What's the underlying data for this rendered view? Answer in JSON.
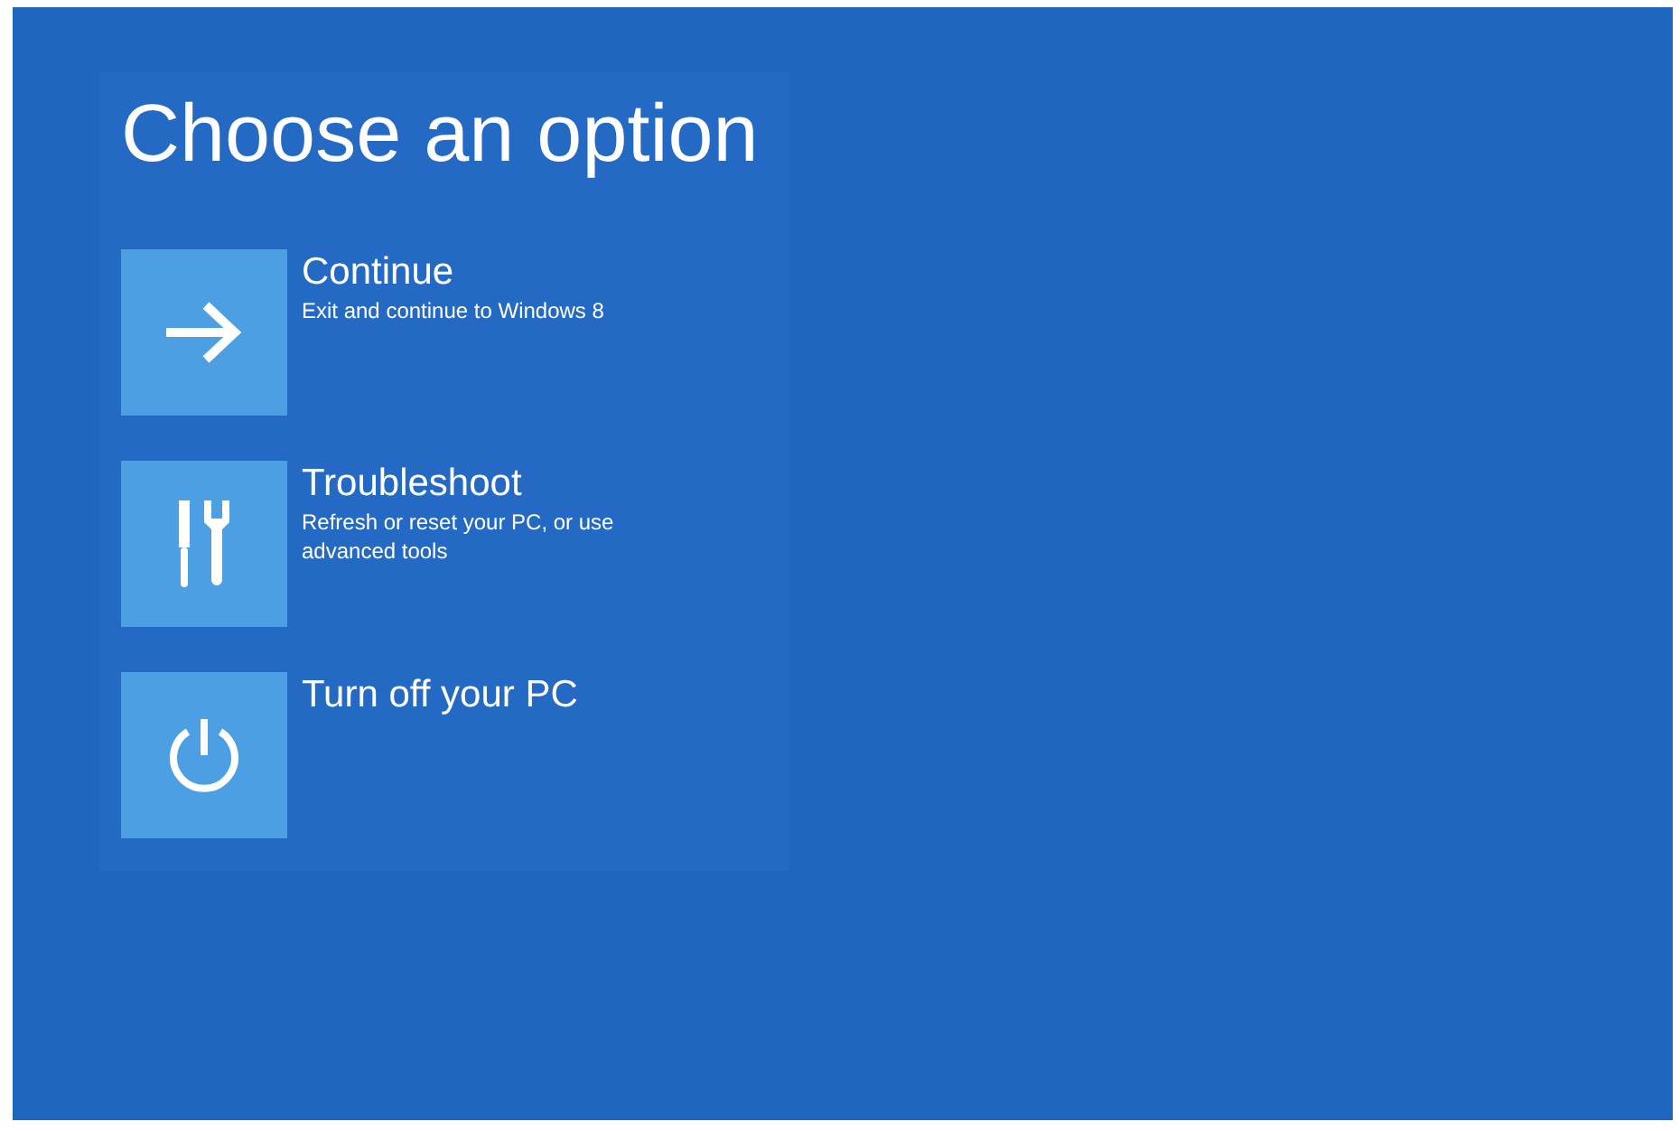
{
  "title": "Choose an option",
  "options": [
    {
      "kind": "continue",
      "label": "Continue",
      "description": "Exit and continue to Windows 8"
    },
    {
      "kind": "troubleshoot",
      "label": "Troubleshoot",
      "description": "Refresh or reset your PC, or use advanced tools"
    },
    {
      "kind": "power",
      "label": "Turn off your PC"
    }
  ]
}
